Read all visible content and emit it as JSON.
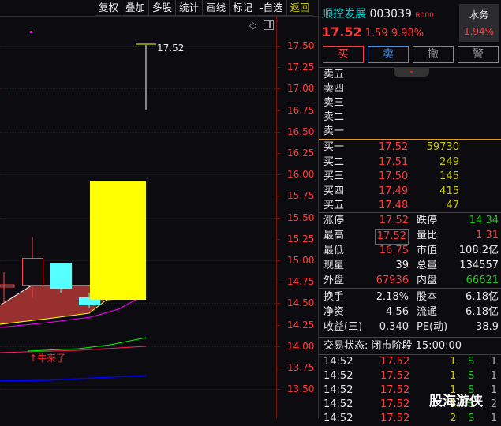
{
  "toolbar": {
    "items": [
      "复权",
      "叠加",
      "多股",
      "统计",
      "画线",
      "标记",
      "-自选"
    ],
    "back": "返回"
  },
  "chart": {
    "price_ticks": [
      "17.50",
      "17.25",
      "17.00",
      "16.75",
      "16.50",
      "16.25",
      "16.00",
      "15.75",
      "15.50",
      "15.25",
      "15.00",
      "14.75",
      "14.50",
      "14.25",
      "14.00",
      "13.75",
      "13.50"
    ],
    "high_label": "17.52",
    "signal_label": "牛来了"
  },
  "stock": {
    "name": "顺控发展",
    "code": "003039",
    "tag": "R000",
    "price": "17.52",
    "change": "1.59",
    "pct": "9.98%",
    "sector": "水务",
    "sector_pct": "1.94%"
  },
  "actions": {
    "buy": "买",
    "sell": "卖",
    "cancel": "撤",
    "alert": "警"
  },
  "asks": [
    {
      "label": "卖五"
    },
    {
      "label": "卖四"
    },
    {
      "label": "卖三"
    },
    {
      "label": "卖二"
    },
    {
      "label": "卖一"
    }
  ],
  "bids": [
    {
      "label": "买一",
      "price": "17.52",
      "vol": "59730"
    },
    {
      "label": "买二",
      "price": "17.51",
      "vol": "249"
    },
    {
      "label": "买三",
      "price": "17.50",
      "vol": "145"
    },
    {
      "label": "买四",
      "price": "17.49",
      "vol": "415"
    },
    {
      "label": "买五",
      "price": "17.48",
      "vol": "47"
    }
  ],
  "stats": [
    {
      "l1": "涨停",
      "v1": "17.52",
      "c1": "red",
      "l2": "跌停",
      "v2": "14.34",
      "c2": "green"
    },
    {
      "l1": "最高",
      "v1": "17.52",
      "c1": "red",
      "l2": "量比",
      "v2": "1.31",
      "c2": "red"
    },
    {
      "l1": "最低",
      "v1": "16.75",
      "c1": "red",
      "l2": "市值",
      "v2": "108.2亿",
      "c2": "white"
    },
    {
      "l1": "现量",
      "v1": "39",
      "c1": "white",
      "l2": "总量",
      "v2": "134557",
      "c2": "white"
    },
    {
      "l1": "外盘",
      "v1": "67936",
      "c1": "red",
      "l2": "内盘",
      "v2": "66621",
      "c2": "green"
    }
  ],
  "fin": [
    {
      "l1": "换手",
      "v1": "2.18%",
      "l2": "股本",
      "v2": "6.18亿"
    },
    {
      "l1": "净资",
      "v1": "4.56",
      "l2": "流通",
      "v2": "6.18亿"
    },
    {
      "l1": "收益(三)",
      "v1": "0.340",
      "l2": "PE(动)",
      "v2": "38.9"
    }
  ],
  "status": "交易状态: 闭市阶段 15:00:00",
  "trades": [
    {
      "t": "14:52",
      "p": "17.52",
      "v": "1",
      "s": "S",
      "n": "1"
    },
    {
      "t": "14:52",
      "p": "17.52",
      "v": "1",
      "s": "S",
      "n": "1"
    },
    {
      "t": "14:52",
      "p": "17.52",
      "v": "1",
      "s": "S",
      "n": "1"
    },
    {
      "t": "14:52",
      "p": "17.52",
      "v": "8",
      "s": "S",
      "n": "2"
    },
    {
      "t": "14:52",
      "p": "17.52",
      "v": "2",
      "s": "S",
      "n": "1"
    }
  ],
  "watermark": "股海游侠"
}
